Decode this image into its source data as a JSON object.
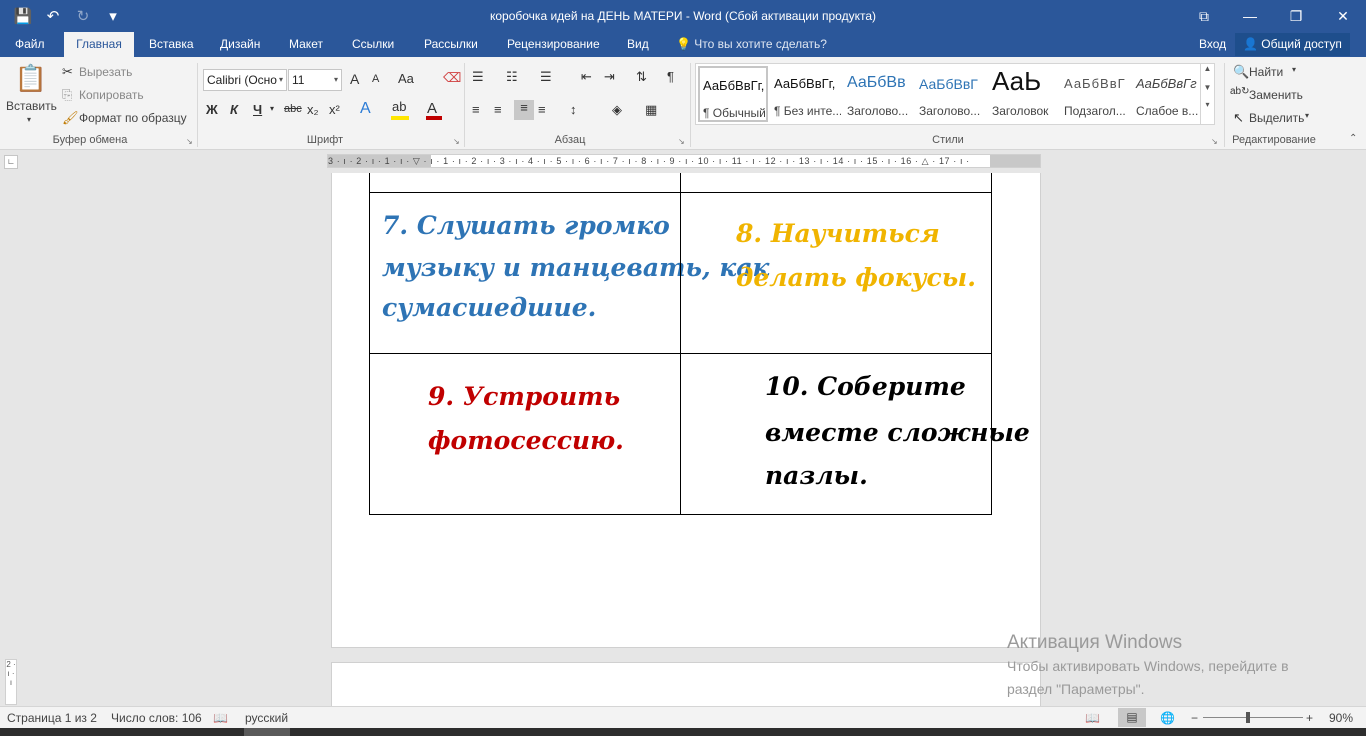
{
  "titlebar": {
    "title": "коробочка идей на ДЕНЬ МАТЕРИ - Word (Сбой активации продукта)",
    "qat": [
      {
        "icon": "save-icon",
        "glyph": "💾"
      },
      {
        "icon": "undo-icon",
        "glyph": "↶"
      },
      {
        "icon": "redo-icon",
        "glyph": "↻"
      },
      {
        "icon": "customize-qat-icon",
        "glyph": "▾"
      }
    ],
    "controls": {
      "ribbon_options": "⧉",
      "minimize": "—",
      "restore": "❐",
      "close": "✕"
    }
  },
  "tabs": [
    "Файл",
    "Главная",
    "Вставка",
    "Дизайн",
    "Макет",
    "Ссылки",
    "Рассылки",
    "Рецензирование",
    "Вид"
  ],
  "active_tab": "Главная",
  "tell_me": "Что вы хотите сделать?",
  "login": "Вход",
  "share": "Общий доступ",
  "ribbon": {
    "clipboard": {
      "label": "Буфер обмена",
      "paste": "Вставить",
      "cut": "Вырезать",
      "copy": "Копировать",
      "format_painter": "Формат по образцу"
    },
    "font": {
      "label": "Шрифт",
      "font_name": "Calibri (Осно",
      "font_size": "11",
      "bold": "Ж",
      "italic": "К",
      "underline": "Ч",
      "strike": "abc",
      "subscript": "x₂",
      "superscript": "x²",
      "case": "Aa",
      "grow": "A",
      "shrink": "A"
    },
    "paragraph": {
      "label": "Абзац"
    },
    "styles": {
      "label": "Стили",
      "items": [
        {
          "preview": "АаБбВвГг,",
          "name": "¶ Обычный"
        },
        {
          "preview": "АаБбВвГг,",
          "name": "¶ Без инте..."
        },
        {
          "preview": "АаБбВв",
          "name": "Заголово..."
        },
        {
          "preview": "АаБбВвГ",
          "name": "Заголово..."
        },
        {
          "preview": "АаЬ",
          "name": "Заголовок"
        },
        {
          "preview": "АаБбВвГ",
          "name": "Подзагол..."
        },
        {
          "preview": "АаБбВвГг",
          "name": "Слабое в..."
        }
      ]
    },
    "editing": {
      "label": "Редактирование",
      "find": "Найти",
      "replace": "Заменить",
      "select": "Выделить"
    }
  },
  "ruler_numbers": "3 · ı · 2 · ı · 1 · ı · ▽ · ı · 1 · ı · 2 · ı · 3 · ı · 4 · ı · 5 · ı · 6 · ı · 7 · ı · 8 · ı · 9 · ı · 10 · ı · 11 · ı · 12 · ı · 13 · ı · 14 · ı · 15 · ı · 16 · △ · 17 · ı ·",
  "vruler_numbers": "2 · ı · ı",
  "document": {
    "cell7": {
      "number": "7.",
      "lines": [
        "Слушать громко",
        "музыку и танцевать, как",
        "сумасшедшие."
      ],
      "color": "#2e74b5"
    },
    "cell8": {
      "number": "8.",
      "lines": [
        "Научиться",
        "делать фокусы."
      ],
      "color": "#f0b400"
    },
    "cell9": {
      "number": "9.",
      "lines": [
        "Устроить",
        "фотосессию."
      ],
      "color": "#c00000"
    },
    "cell10": {
      "number": "10.",
      "lines": [
        "Соберите",
        "вместе сложные",
        "пазлы."
      ],
      "color": "#000000"
    }
  },
  "activation": {
    "heading": "Активация Windows",
    "line1": "Чтобы активировать Windows, перейдите в",
    "line2": "раздел \"Параметры\"."
  },
  "statusbar": {
    "page": "Страница 1 из 2",
    "words": "Число слов: 106",
    "language": "русский",
    "zoom": "90%",
    "zoom_minus": "−",
    "zoom_plus": "+",
    "zoom_level": 0.45
  },
  "colors": {
    "accent": "#2b579a"
  }
}
